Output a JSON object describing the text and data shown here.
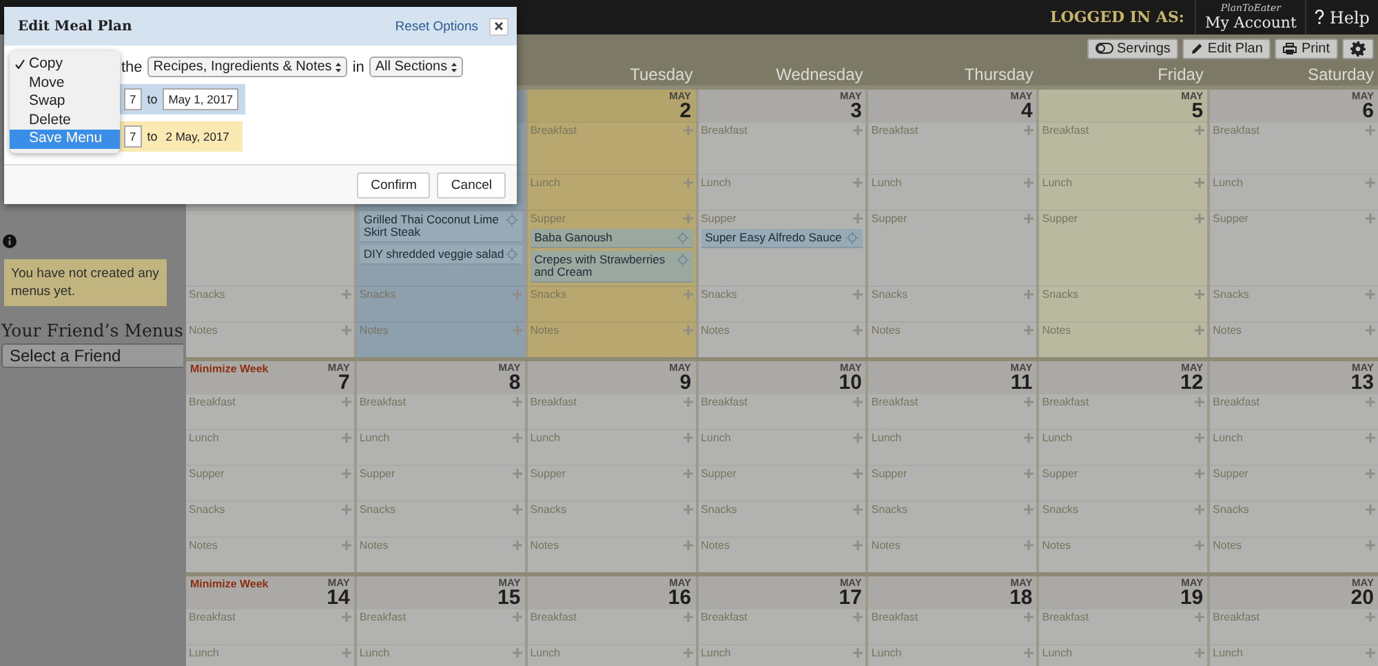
{
  "top_bar": {
    "logged_in_label": "LOGGED IN AS:",
    "account_caption": "PlanToEater",
    "account_link": "My Account",
    "help": "Help"
  },
  "toolbar": {
    "buttons": [
      {
        "kind": "servings",
        "label": "Servings"
      },
      {
        "kind": "edit",
        "label": "Edit Plan"
      },
      {
        "kind": "print",
        "label": "Print"
      },
      {
        "kind": "settings"
      }
    ]
  },
  "sidebar": {
    "notice": "You have not created any menus yet.",
    "friends_heading": "Your Friend’s Menus",
    "friend_select": "Select a Friend"
  },
  "calendar": {
    "day_names": [
      "Tuesday",
      "Wednesday",
      "Thursday",
      "Friday",
      "Saturday"
    ],
    "weeks": [
      {
        "days": [
          {
            "selected": false,
            "copy_target": false,
            "today": false,
            "sections": [
              {
                "label": "Snacks"
              },
              {
                "label": "Notes"
              }
            ]
          },
          {
            "selected": true,
            "copy_target": false,
            "today": false,
            "sections": [
              {
                "items": [
                  "Grilled Thai Coconut Lime Skirt Steak",
                  "DIY shredded veggie salad"
                ]
              },
              {
                "label": "Snacks"
              },
              {
                "label": "Notes"
              }
            ]
          },
          {
            "month": "MAY",
            "date": "2",
            "selected": false,
            "copy_target": true,
            "today": false,
            "sections": [
              {
                "label": "Breakfast"
              },
              {
                "label": "Lunch"
              },
              {
                "label": "Supper",
                "items": [
                  "Baba Ganoush",
                  "Crepes with Strawberries and Cream"
                ]
              },
              {
                "label": "Snacks"
              },
              {
                "label": "Notes"
              }
            ]
          },
          {
            "month": "MAY",
            "date": "3",
            "selected": false,
            "copy_target": false,
            "today": false,
            "sections": [
              {
                "label": "Breakfast"
              },
              {
                "label": "Lunch"
              },
              {
                "label": "Supper",
                "items": [
                  "Super Easy Alfredo Sauce"
                ]
              },
              {
                "label": "Snacks"
              },
              {
                "label": "Notes"
              }
            ]
          },
          {
            "month": "MAY",
            "date": "4",
            "selected": false,
            "copy_target": false,
            "today": false,
            "sections": [
              {
                "label": "Breakfast"
              },
              {
                "label": "Lunch"
              },
              {
                "label": "Supper"
              },
              {
                "label": "Snacks"
              },
              {
                "label": "Notes"
              }
            ]
          },
          {
            "month": "MAY",
            "date": "5",
            "selected": false,
            "copy_target": false,
            "today": true,
            "sections": [
              {
                "label": "Breakfast"
              },
              {
                "label": "Lunch"
              },
              {
                "label": "Supper"
              },
              {
                "label": "Snacks"
              },
              {
                "label": "Notes"
              }
            ]
          },
          {
            "month": "MAY",
            "date": "6",
            "selected": false,
            "copy_target": false,
            "today": false,
            "sections": [
              {
                "label": "Breakfast"
              },
              {
                "label": "Lunch"
              },
              {
                "label": "Supper"
              },
              {
                "label": "Snacks"
              },
              {
                "label": "Notes"
              }
            ]
          }
        ]
      },
      {
        "minimize_label": "Minimize Week",
        "days": [
          {
            "month": "MAY",
            "date": "7",
            "selected": false,
            "copy_target": false,
            "today": false,
            "sections": [
              {
                "label": "Breakfast"
              },
              {
                "label": "Lunch"
              },
              {
                "label": "Supper"
              },
              {
                "label": "Snacks"
              },
              {
                "label": "Notes"
              }
            ]
          },
          {
            "month": "MAY",
            "date": "8",
            "selected": false,
            "copy_target": false,
            "today": false,
            "sections": [
              {
                "label": "Breakfast"
              },
              {
                "label": "Lunch"
              },
              {
                "label": "Supper"
              },
              {
                "label": "Snacks"
              },
              {
                "label": "Notes"
              }
            ]
          },
          {
            "month": "MAY",
            "date": "9",
            "selected": false,
            "copy_target": false,
            "today": false,
            "sections": [
              {
                "label": "Breakfast"
              },
              {
                "label": "Lunch"
              },
              {
                "label": "Supper"
              },
              {
                "label": "Snacks"
              },
              {
                "label": "Notes"
              }
            ]
          },
          {
            "month": "MAY",
            "date": "10",
            "selected": false,
            "copy_target": false,
            "today": false,
            "sections": [
              {
                "label": "Breakfast"
              },
              {
                "label": "Lunch"
              },
              {
                "label": "Supper"
              },
              {
                "label": "Snacks"
              },
              {
                "label": "Notes"
              }
            ]
          },
          {
            "month": "MAY",
            "date": "11",
            "selected": false,
            "copy_target": false,
            "today": false,
            "sections": [
              {
                "label": "Breakfast"
              },
              {
                "label": "Lunch"
              },
              {
                "label": "Supper"
              },
              {
                "label": "Snacks"
              },
              {
                "label": "Notes"
              }
            ]
          },
          {
            "month": "MAY",
            "date": "12",
            "selected": false,
            "copy_target": false,
            "today": false,
            "sections": [
              {
                "label": "Breakfast"
              },
              {
                "label": "Lunch"
              },
              {
                "label": "Supper"
              },
              {
                "label": "Snacks"
              },
              {
                "label": "Notes"
              }
            ]
          },
          {
            "month": "MAY",
            "date": "13",
            "selected": false,
            "copy_target": false,
            "today": false,
            "sections": [
              {
                "label": "Breakfast"
              },
              {
                "label": "Lunch"
              },
              {
                "label": "Supper"
              },
              {
                "label": "Snacks"
              },
              {
                "label": "Notes"
              }
            ]
          }
        ]
      },
      {
        "minimize_label": "Minimize Week",
        "days": [
          {
            "month": "MAY",
            "date": "14",
            "selected": false,
            "copy_target": false,
            "today": false,
            "sections": [
              {
                "label": "Breakfast"
              },
              {
                "label": "Lunch"
              }
            ]
          },
          {
            "month": "MAY",
            "date": "15",
            "selected": false,
            "copy_target": false,
            "today": false,
            "sections": [
              {
                "label": "Breakfast"
              },
              {
                "label": "Lunch"
              }
            ]
          },
          {
            "month": "MAY",
            "date": "16",
            "selected": false,
            "copy_target": false,
            "today": false,
            "sections": [
              {
                "label": "Breakfast"
              },
              {
                "label": "Lunch"
              }
            ]
          },
          {
            "month": "MAY",
            "date": "17",
            "selected": false,
            "copy_target": false,
            "today": false,
            "sections": [
              {
                "label": "Breakfast"
              },
              {
                "label": "Lunch"
              }
            ]
          },
          {
            "month": "MAY",
            "date": "18",
            "selected": false,
            "copy_target": false,
            "today": false,
            "sections": [
              {
                "label": "Breakfast"
              },
              {
                "label": "Lunch"
              }
            ]
          },
          {
            "month": "MAY",
            "date": "19",
            "selected": false,
            "copy_target": false,
            "today": false,
            "sections": [
              {
                "label": "Breakfast"
              },
              {
                "label": "Lunch"
              }
            ]
          },
          {
            "month": "MAY",
            "date": "20",
            "selected": false,
            "copy_target": false,
            "today": false,
            "sections": [
              {
                "label": "Breakfast"
              },
              {
                "label": "Lunch"
              }
            ]
          }
        ]
      }
    ]
  },
  "dialog": {
    "title": "Edit Meal Plan",
    "reset_link": "Reset Options",
    "action_menu": [
      {
        "label": "Copy",
        "checked": true,
        "highlighted": false
      },
      {
        "label": "Move",
        "checked": false,
        "highlighted": false
      },
      {
        "label": "Swap",
        "checked": false,
        "highlighted": false
      },
      {
        "label": "Delete",
        "checked": false,
        "highlighted": false
      },
      {
        "label": "Save Menu",
        "checked": false,
        "highlighted": true
      }
    ],
    "word_the": "the",
    "content_select": "Recipes, Ingredients & Notes",
    "word_in": "in",
    "sections_select": "All Sections",
    "source": {
      "from": "7",
      "word_to": "to",
      "to": "May 1, 2017"
    },
    "target": {
      "from": "7",
      "word_to": "to",
      "to": "2 May, 2017"
    },
    "buttons": [
      "Confirm",
      "Cancel"
    ]
  }
}
